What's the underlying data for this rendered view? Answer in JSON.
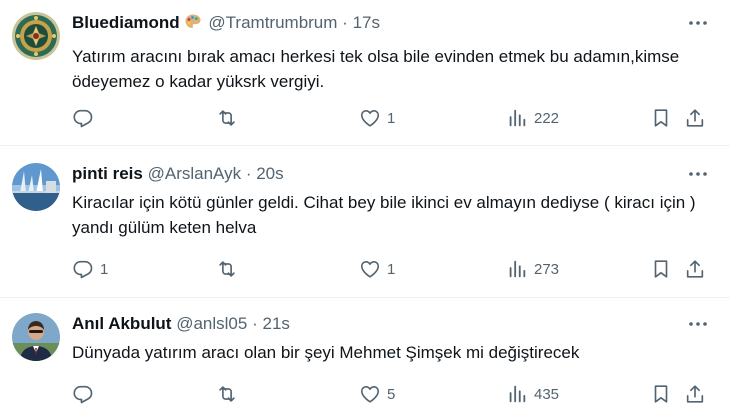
{
  "tweets": [
    {
      "display_name": "Bluediamond",
      "handle": "@Tramtrumbrum",
      "separator": "·",
      "time": "17s",
      "text": "Yatırım aracını bırak amacı herkesi tek olsa bile evinden etmek bu adamın,kimse ödeyemez o kadar yüksrk vergiyi.",
      "replies": "",
      "reposts": "",
      "likes": "1",
      "views": "222",
      "avatar_icon": "ornate-green-gold-emblem",
      "name_emoji": "artist-palette-emoji"
    },
    {
      "display_name": "pinti reis",
      "handle": "@ArslanAyk",
      "separator": "·",
      "time": "20s",
      "text": "Kiracılar için kötü günler  geldi. Cihat bey bile ikinci ev almayın dediyse ( kiracı için ) yandı gülüm keten helva",
      "replies": "1",
      "reposts": "",
      "likes": "1",
      "views": "273",
      "avatar_icon": "sea-bridge-photo"
    },
    {
      "display_name": "Anıl Akbulut",
      "handle": "@anlsl05",
      "separator": "·",
      "time": "21s",
      "text": "Dünyada yatırım aracı olan bir şeyi Mehmet Şimşek mi değiştirecek",
      "replies": "",
      "reposts": "",
      "likes": "5",
      "views": "435",
      "avatar_icon": "man-in-suit-photo"
    }
  ],
  "icons": {
    "reply": "reply-icon",
    "repost": "repost-icon",
    "like": "like-icon",
    "views": "views-icon",
    "bookmark": "bookmark-icon",
    "share": "share-icon",
    "more": "more-icon"
  },
  "colors": {
    "text_primary": "#0f1419",
    "text_secondary": "#536471",
    "divider": "#eff3f4"
  }
}
